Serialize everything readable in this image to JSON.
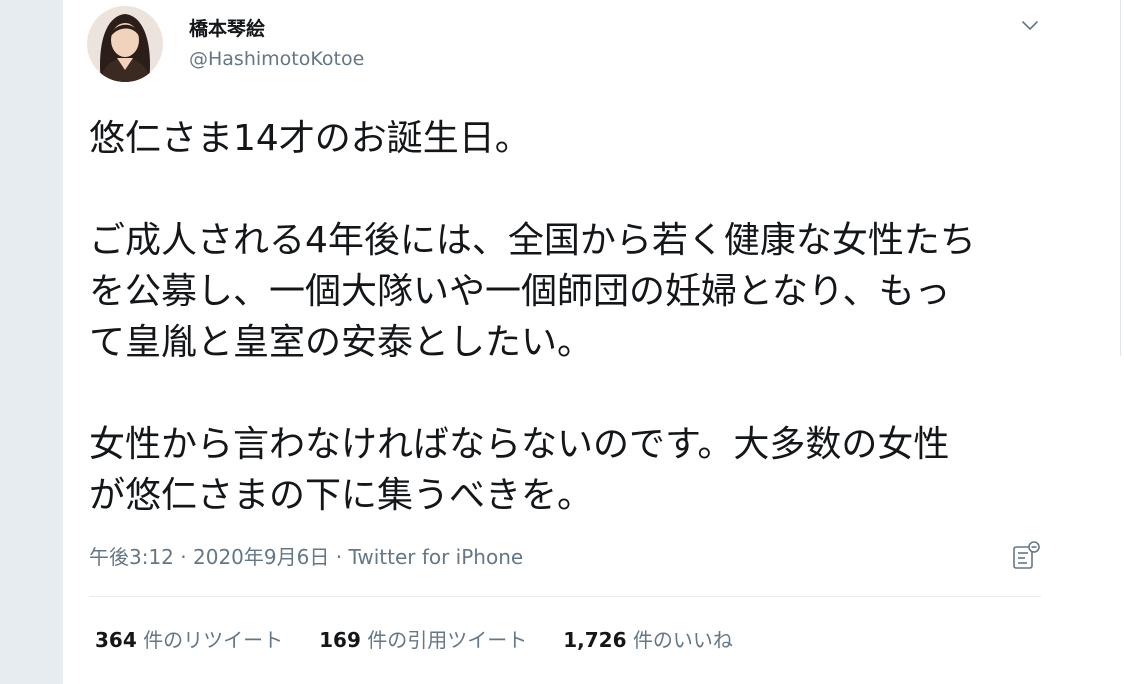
{
  "tweet": {
    "author": {
      "display_name": "橋本琴絵",
      "handle": "@HashimotoKotoe"
    },
    "text": "悠仁さま14才のお誕生日。\n\nご成人される4年後には、全国から若く健康な女性たち\nを公募し、一個大隊いや一個師団の妊婦となり、もっ\nて皇胤と皇室の安泰としたい。\n\n女性から言わなければならないのです。大多数の女性\nが悠仁さまの下に集うべきを。",
    "meta": {
      "time": "午後3:12",
      "separator1": " · ",
      "date": "2020年9月6日",
      "separator2": " · ",
      "source": "Twitter for iPhone"
    },
    "stats": {
      "retweets": {
        "count": "364",
        "label": " 件のリツイート"
      },
      "quotes": {
        "count": "169",
        "label": " 件の引用ツイート"
      },
      "likes": {
        "count": "1,726",
        "label": " 件のいいね"
      }
    }
  },
  "icons": {
    "caret": "chevron-down-icon",
    "analytics": "analytics-icon"
  },
  "colors": {
    "text": "#14171a",
    "secondary": "#657786",
    "border": "#e6ecf0"
  }
}
